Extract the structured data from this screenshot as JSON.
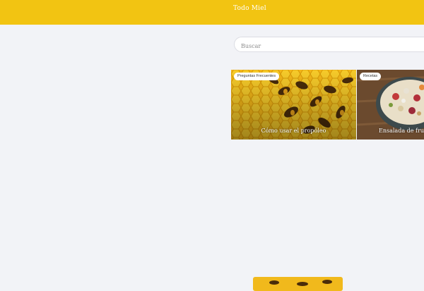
{
  "header": {
    "site_title": "Todo Miel"
  },
  "search": {
    "placeholder": "Buscar",
    "value": ""
  },
  "posts": [
    {
      "category": "Preguntas Frecuentes",
      "title": "Cómo usar el propóleo"
    },
    {
      "category": "Recetas",
      "title": "Ensalada de frutos"
    }
  ],
  "colors": {
    "header_bg": "#f2c412",
    "page_bg": "#f2f3f7"
  }
}
